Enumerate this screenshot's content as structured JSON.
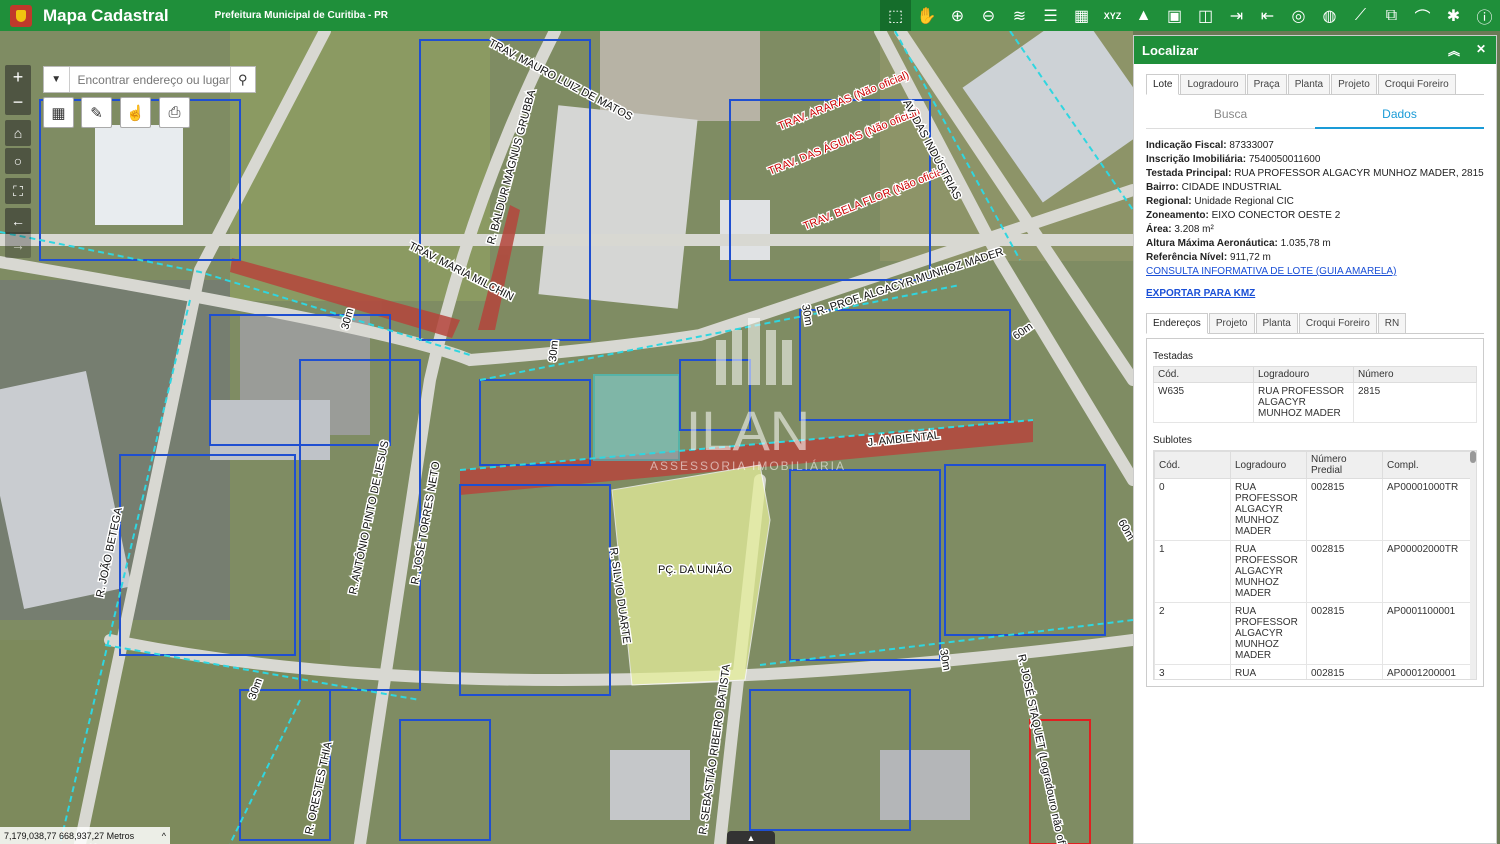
{
  "app": {
    "title": "Mapa Cadastral",
    "subtitle": "Prefeitura Municipal de Curitiba - PR"
  },
  "toolbar": {
    "icons": [
      "select-icon",
      "pan-icon",
      "zoom-in-icon",
      "zoom-out-icon",
      "layers-icon",
      "list-icon",
      "grid-icon",
      "xyz-icon",
      "education-icon",
      "building-icon",
      "split-icon",
      "import-icon",
      "export-icon",
      "target-icon",
      "globe-icon",
      "measure-icon",
      "overlay-icon",
      "terrain-icon",
      "settings-icon",
      "info-icon"
    ],
    "xyz_label": "XYZ"
  },
  "map": {
    "search_placeholder": "Encontrar endereço ou lugar",
    "coords": "7,179,038,77 668,937,27 Metros",
    "scale_label": "60m",
    "streets": {
      "trav_mauro": "TRAV. MAURO LUIZ DE MATOS",
      "baldur": "R. BALDUR MAGNUS GRUBBA",
      "maria": "TRAV. MARIA MILCHIN",
      "araras": "TRAV. ARARAS (Não oficial)",
      "aguias": "TRAV. DAS ÁGUIAS (Não oficial)",
      "bela_flor": "TRAV. BELA FLOR (Não oficial)",
      "industrias": "AV. DAS INDÚSTRIAS",
      "algacyr": "R. PROF. ALGACYR MUNHOZ MADER",
      "ambiental": "J. AMBIENTAL",
      "praca": "PÇ. DA UNIÃO",
      "silvio": "R. SILVIO DUARTE",
      "jose": "R. JOSÉ TORRES NETO",
      "antonio": "R. ANTÔNIO PINTO DE JESUS",
      "joao": "R. JOÃO BETEGA",
      "sebastiao": "R. SEBASTIÃO RIBEIRO BATISTA",
      "orestes": "R. ORESTES THIA",
      "staciaquet": "R. JOSÉ STAQUET (Logradouro não oficial)",
      "m30a": "30m",
      "m30b": "30m",
      "m30c": "30m",
      "m30d": "30m",
      "m30e": "30m",
      "m60a": "60m",
      "m60b": "60m"
    },
    "watermark": {
      "name": "ILAN",
      "sub": "ASSESSORIA IMOBILIÁRIA"
    }
  },
  "panel": {
    "title": "Localizar",
    "tabs": [
      "Lote",
      "Logradouro",
      "Praça",
      "Planta",
      "Projeto",
      "Croqui Foreiro"
    ],
    "subtabs": [
      "Busca",
      "Dados"
    ],
    "info": {
      "indicacao_label": "Indicação Fiscal:",
      "indicacao": "87333007",
      "inscricao_label": "Inscrição Imobiliária:",
      "inscricao": "7540050011600",
      "testada_label": "Testada Principal:",
      "testada": "RUA PROFESSOR ALGACYR MUNHOZ MADER, 2815",
      "bairro_label": "Bairro:",
      "bairro": "CIDADE INDUSTRIAL",
      "regional_label": "Regional:",
      "regional": "Unidade Regional CIC",
      "zoneamento_label": "Zoneamento:",
      "zoneamento": "EIXO CONECTOR OESTE 2",
      "area_label": "Área:",
      "area": "3.208 m²",
      "altura_label": "Altura Máxima Aeronáutica:",
      "altura": "1.035,78 m",
      "referencia_label": "Referência Nível:",
      "referencia": "911,72 m"
    },
    "link_consulta": "CONSULTA INFORMATIVA DE LOTE (GUIA AMARELA)",
    "link_kmz": "EXPORTAR PARA KMZ",
    "inner_tabs": [
      "Endereços",
      "Projeto",
      "Planta",
      "Croqui Foreiro",
      "RN"
    ],
    "testadas": {
      "title": "Testadas",
      "headers": [
        "Cód.",
        "Logradouro",
        "Número"
      ],
      "rows": [
        [
          "W635",
          "RUA PROFESSOR ALGACYR MUNHOZ MADER",
          "2815"
        ]
      ]
    },
    "sublotes": {
      "title": "Sublotes",
      "headers": [
        "Cód.",
        "Logradouro",
        "Número Predial",
        "Compl."
      ],
      "rows": [
        [
          "0",
          "RUA PROFESSOR ALGACYR MUNHOZ MADER",
          "002815",
          "AP00001000TR"
        ],
        [
          "1",
          "RUA PROFESSOR ALGACYR MUNHOZ MADER",
          "002815",
          "AP00002000TR"
        ],
        [
          "2",
          "RUA PROFESSOR ALGACYR MUNHOZ MADER",
          "002815",
          "AP0001100001"
        ],
        [
          "3",
          "RUA PROFESSOR ALGACYR",
          "002815",
          "AP0001200001"
        ]
      ]
    }
  }
}
